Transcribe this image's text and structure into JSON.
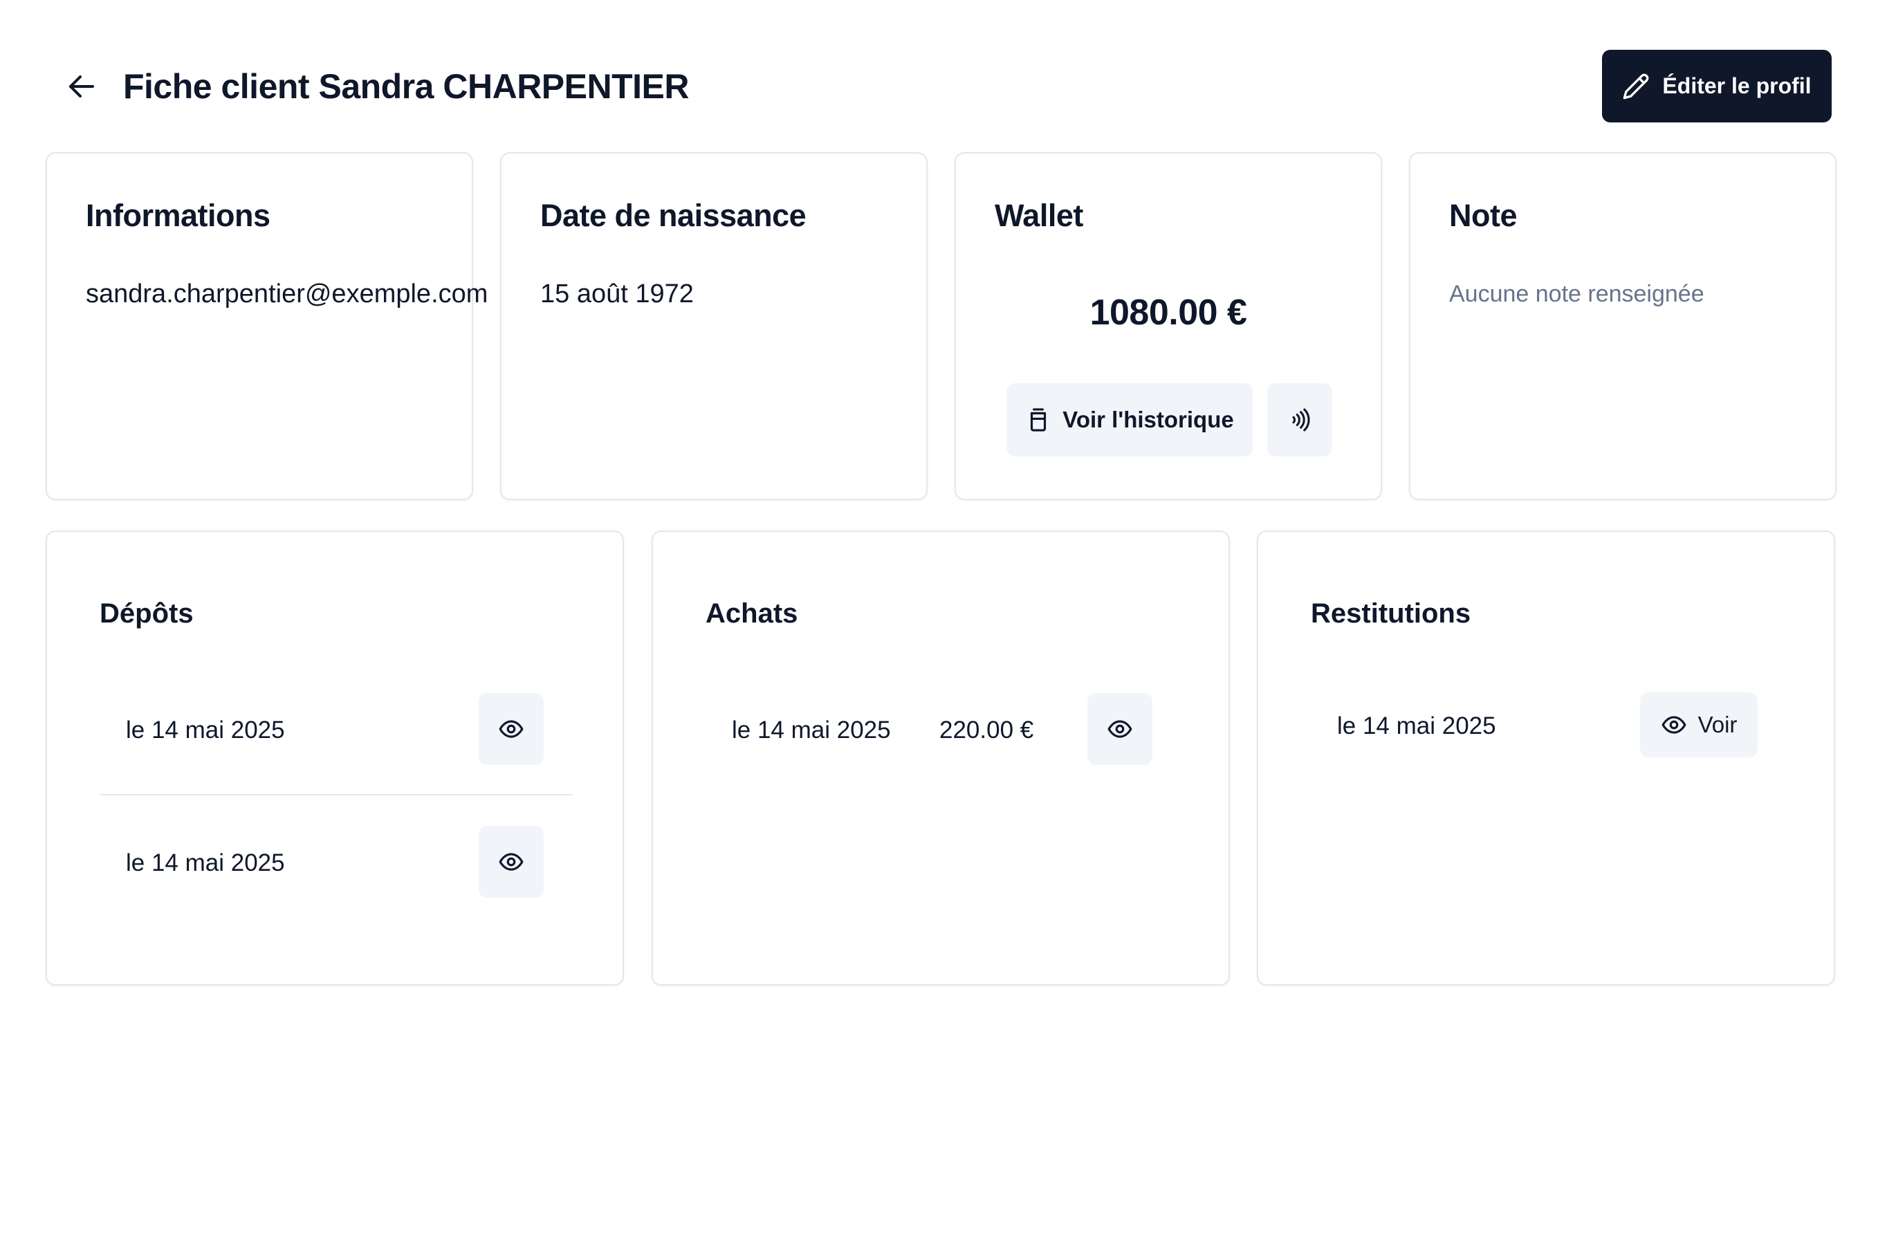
{
  "header": {
    "title": "Fiche client Sandra CHARPENTIER",
    "edit_label": "Éditer le profil",
    "back_icon": "arrow-left-icon",
    "edit_icon": "pencil-icon"
  },
  "cards": {
    "informations": {
      "title": "Informations",
      "value": "sandra.charpentier@exemple.com"
    },
    "birth": {
      "title": "Date de naissance",
      "value": "15 août 1972"
    },
    "wallet": {
      "title": "Wallet",
      "amount": "1080.00 €",
      "history_label": "Voir l'historique",
      "history_icon": "jar-icon",
      "nfc_icon": "contactless-icon"
    },
    "note": {
      "title": "Note",
      "value": "Aucune note renseignée"
    }
  },
  "depots": {
    "title": "Dépôts",
    "items": [
      {
        "date": "le 14 mai 2025"
      },
      {
        "date": "le 14 mai 2025"
      }
    ]
  },
  "achats": {
    "title": "Achats",
    "items": [
      {
        "date": "le 14 mai 2025",
        "amount": "220.00 €"
      }
    ]
  },
  "restitutions": {
    "title": "Restitutions",
    "items": [
      {
        "date": "le 14 mai 2025",
        "action_label": "Voir"
      }
    ]
  },
  "colors": {
    "primary": "#0f172a",
    "muted_text": "#64748b",
    "button_bg": "#f1f5f9",
    "border": "#e5e7eb"
  }
}
